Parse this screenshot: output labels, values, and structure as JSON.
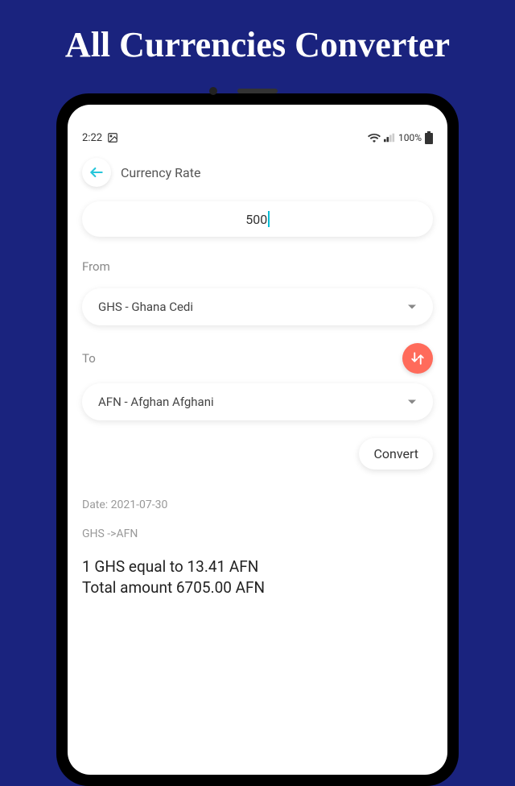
{
  "banner": "All Currencies Converter",
  "status": {
    "time": "2:22",
    "battery": "100%"
  },
  "header": {
    "title": "Currency Rate"
  },
  "amount": {
    "value": "500"
  },
  "from": {
    "label": "From",
    "selected": "GHS - Ghana Cedi"
  },
  "to": {
    "label": "To",
    "selected": "AFN - Afghan Afghani"
  },
  "convert": {
    "label": "Convert"
  },
  "result": {
    "date_label": "Date: 2021-07-30",
    "direction": "GHS ->AFN",
    "rate_line": "1 GHS equal to 13.41 AFN",
    "total_line": "Total amount 6705.00 AFN"
  }
}
